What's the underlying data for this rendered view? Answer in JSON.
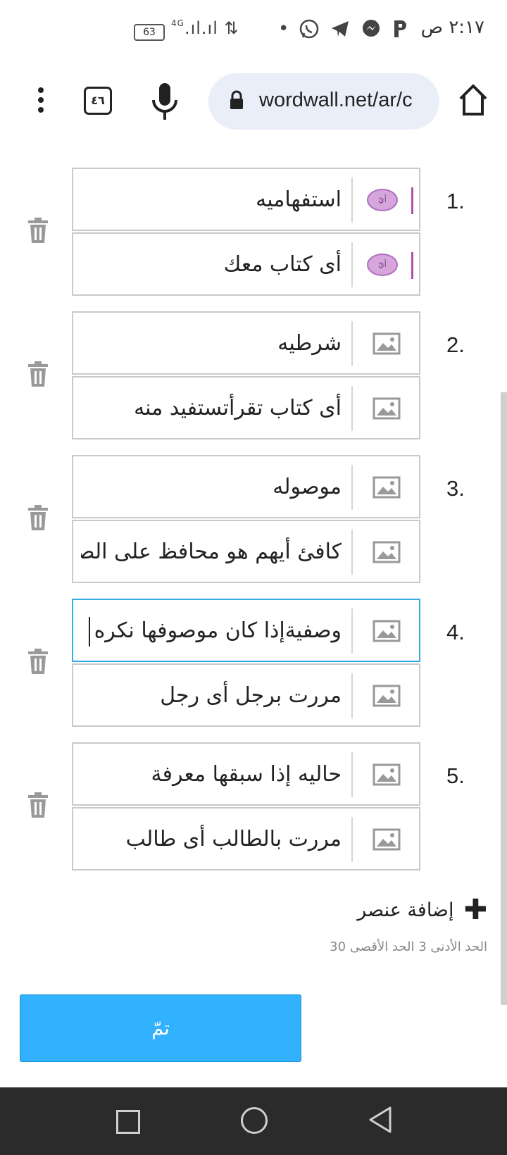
{
  "status_bar": {
    "time": "٢:١٧ ص",
    "battery": "63",
    "network": "4G",
    "app_icons": [
      "dot-icon",
      "whatsapp-icon",
      "telegram-icon",
      "messenger-icon",
      "p-app-icon"
    ]
  },
  "browser": {
    "url": "wordwall.net/ar/c",
    "tabs_count": "٤٦"
  },
  "items": [
    {
      "number": "1.",
      "prompt": "استفهاميه",
      "answer": "أى كتاب معك",
      "has_badges": true,
      "badge_label": "أيّ"
    },
    {
      "number": "2.",
      "prompt": "شرطيه",
      "answer": "أى كتاب تقرأتستفيد منه"
    },
    {
      "number": "3.",
      "prompt": "موصوله",
      "answer": "كافئ أيهم هو محافظ على الصلاه"
    },
    {
      "number": "4.",
      "prompt": "وصفيةإذا كان موصوفها نكره",
      "answer": "مررت برجل أى رجل",
      "active": true
    },
    {
      "number": "5.",
      "prompt": "حاليه إذا سبقها معرفة",
      "answer": "مررت بالطالب أى طالب"
    }
  ],
  "add_item_label": "إضافة عنصر",
  "limits_text": "الحد الأدنى 3   الحد الأقصى 30",
  "done_label": "تمّ",
  "colors": {
    "done_button": "#32b1ff",
    "active_border": "#36a9e8",
    "badge": "#d6a5dc",
    "navbar": "#2b2b2b"
  }
}
